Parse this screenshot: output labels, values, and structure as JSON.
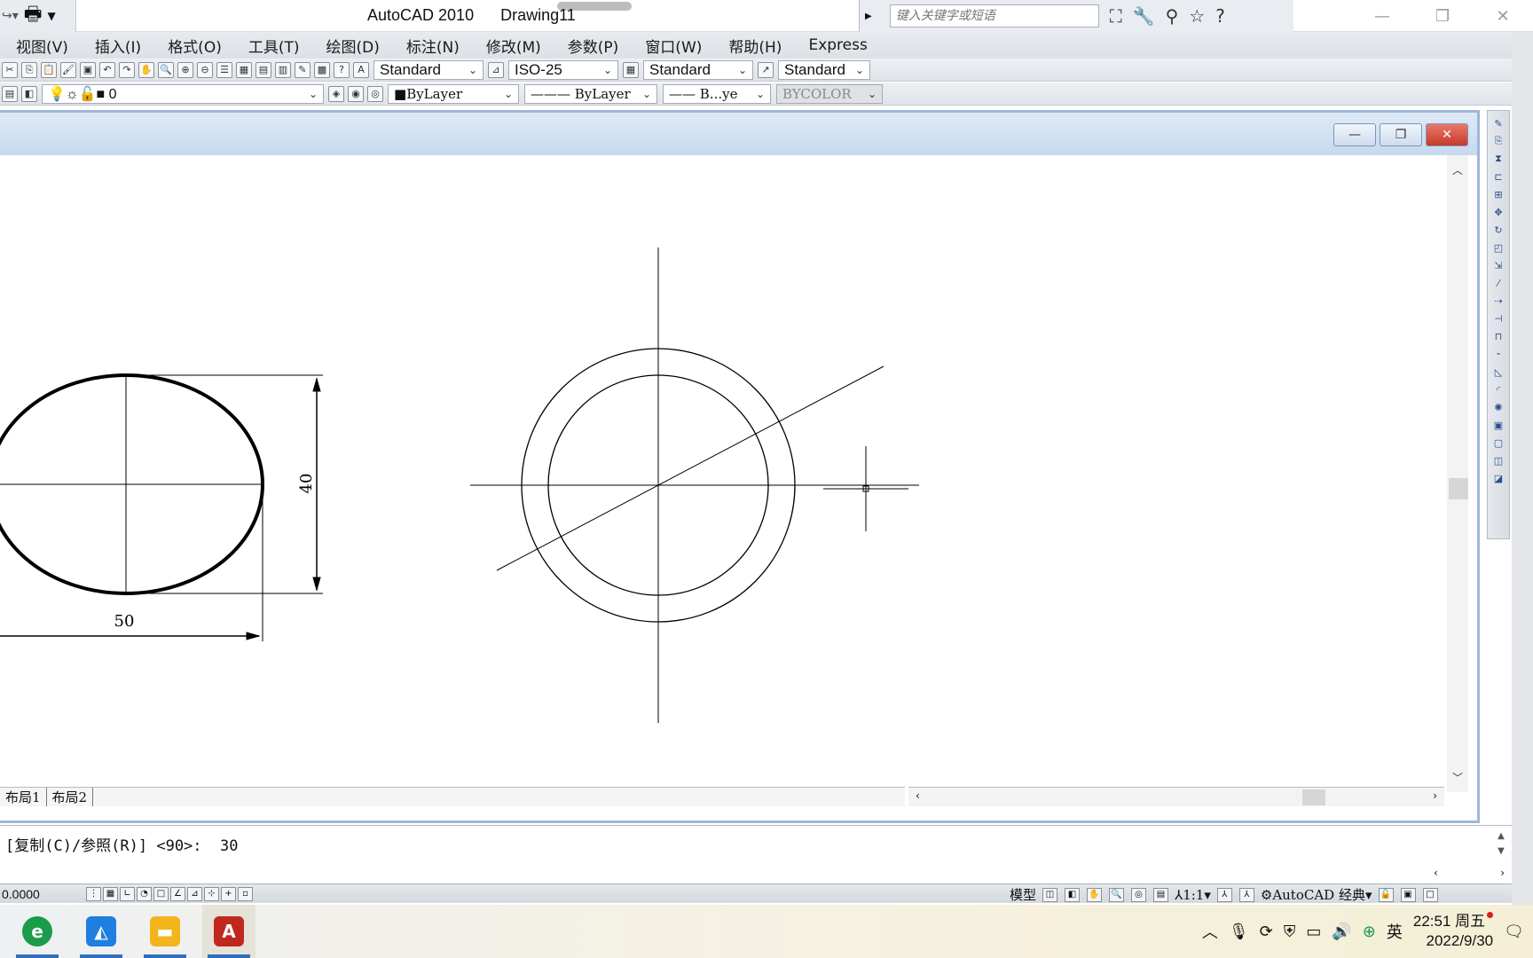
{
  "app": {
    "title": "AutoCAD 2010",
    "document": "Drawing11",
    "search_placeholder": "键入关键字或短语"
  },
  "menu": [
    "视图(V)",
    "插入(I)",
    "格式(O)",
    "工具(T)",
    "绘图(D)",
    "标注(N)",
    "修改(M)",
    "参数(P)",
    "窗口(W)",
    "帮助(H)",
    "Express"
  ],
  "styles_toolbar": {
    "text_style": "Standard",
    "dim_style": "ISO-25",
    "table_style": "Standard",
    "multileader_style": "Standard"
  },
  "layers_toolbar": {
    "current_layer": "0",
    "color": "ByLayer",
    "linetype": "ByLayer",
    "lineweight": "B...ye",
    "plot_style": "BYCOLOR"
  },
  "drawing": {
    "dim_width": "50",
    "dim_height": "40"
  },
  "layout_tabs": [
    "布局1",
    "布局2"
  ],
  "command_line": "[复制(C)/参照(R)] <90>:  30",
  "status": {
    "coords": "0.0000",
    "model": "模型",
    "annotation_scale": "1:1",
    "workspace": "AutoCAD 经典"
  },
  "taskbar": {
    "time": "22:51 周五",
    "date": "2022/9/30",
    "ime": "英"
  },
  "colors": {
    "accent": "#2f6fbd",
    "close_button": "#c63b2a",
    "drawing_frame": "#9fb7d8"
  }
}
